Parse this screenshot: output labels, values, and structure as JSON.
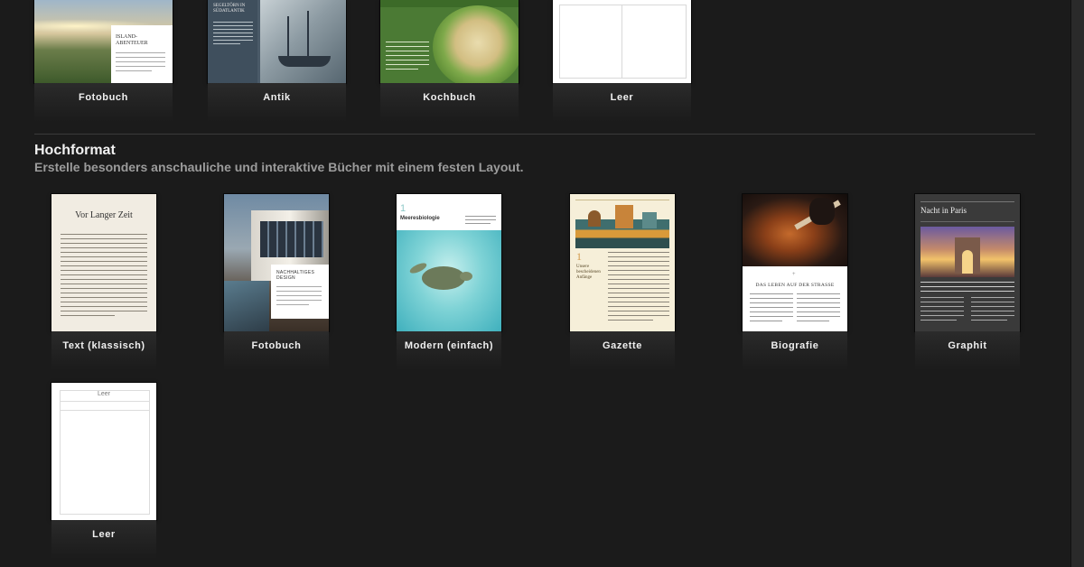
{
  "top_row": [
    {
      "label": "Fotobuch",
      "thumb_title": "ISLAND-\nABENTEUER"
    },
    {
      "label": "Antik",
      "thumb_title": "SEGELTÖRN IN\nSÜDATLANTIK"
    },
    {
      "label": "Kochbuch"
    },
    {
      "label": "Leer"
    }
  ],
  "section": {
    "title": "Hochformat",
    "subtitle": "Erstelle besonders anschauliche und interaktive Bücher mit einem festen Layout."
  },
  "portrait_row": [
    {
      "label": "Text (klassisch)",
      "thumb_title": "Vor Langer Zeit"
    },
    {
      "label": "Fotobuch",
      "thumb_title": "NACHHALTIGES\nDESIGN"
    },
    {
      "label": "Modern (einfach)",
      "thumb_number": "1",
      "thumb_title": "Meeresbiologie"
    },
    {
      "label": "Gazette",
      "thumb_number": "1",
      "thumb_title": "Unsere\nbescheidenen\nAnfänge"
    },
    {
      "label": "Biografie",
      "thumb_title": "DAS LEBEN AUF DER STRASSE"
    },
    {
      "label": "Graphit",
      "thumb_title": "Nacht in Paris"
    }
  ],
  "last_row": [
    {
      "label": "Leer",
      "thumb_title": "Leer"
    }
  ]
}
